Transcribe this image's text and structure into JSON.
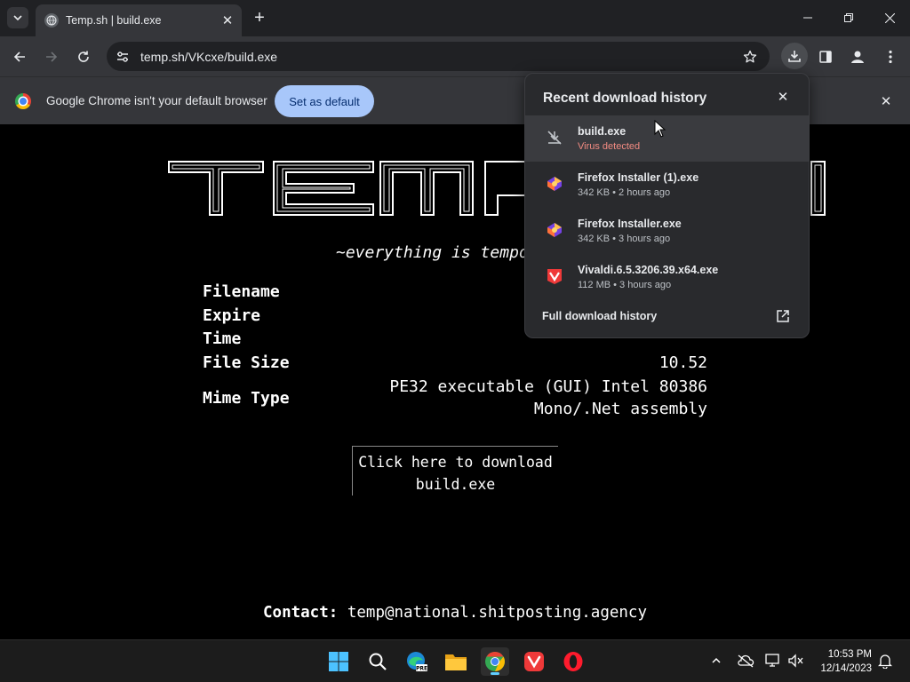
{
  "browser": {
    "tab_title": "Temp.sh | build.exe",
    "new_tab_label": "+",
    "url": "temp.sh/VKcxe/build.exe"
  },
  "infobar": {
    "message": "Google Chrome isn't your default browser",
    "button_label": "Set as default"
  },
  "page": {
    "logo_text": "TEMP.SH",
    "tagline": "~everything is temporary",
    "meta": {
      "filename_label": "Filename",
      "expire_label": "Expire",
      "time_label": "Time",
      "filesize_label": "File Size",
      "filesize_value": "10.52",
      "mimetype_label": "Mime Type",
      "mimetype_value_line1": "PE32 executable (GUI) Intel 80386",
      "mimetype_value_line2": "Mono/.Net assembly"
    },
    "download_line1": "Click here to download",
    "download_line2": "build.exe",
    "contact_label": "Contact:",
    "contact_email": "temp@national.shitposting.agency"
  },
  "downloads_popup": {
    "title": "Recent download history",
    "items": [
      {
        "name": "build.exe",
        "sub": "Virus detected",
        "icon": "download-blocked-icon"
      },
      {
        "name": "Firefox Installer (1).exe",
        "sub": "342 KB • 2 hours ago",
        "icon": "firefox-installer-icon"
      },
      {
        "name": "Firefox Installer.exe",
        "sub": "342 KB • 3 hours ago",
        "icon": "firefox-installer-icon"
      },
      {
        "name": "Vivaldi.6.5.3206.39.x64.exe",
        "sub": "112 MB • 3 hours ago",
        "icon": "vivaldi-installer-icon"
      }
    ],
    "footer_label": "Full download history"
  },
  "taskbar": {
    "time": "10:53 PM",
    "date": "12/14/2023",
    "accent": "#60cdff"
  },
  "colors": {
    "toolbar": "#35363a",
    "tabstrip": "#202124",
    "popup": "#292a2d",
    "danger": "#f28b82",
    "button": "#a8c7fa"
  }
}
